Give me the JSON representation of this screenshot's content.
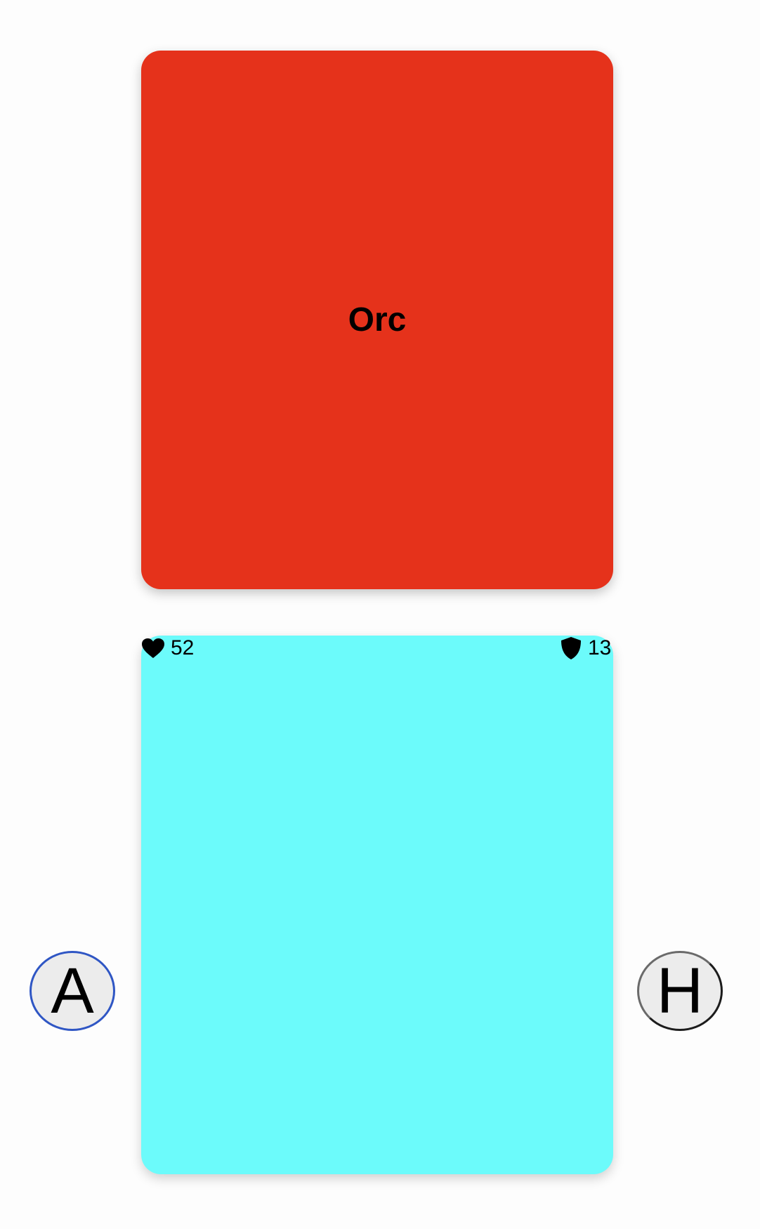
{
  "enemy": {
    "name": "Orc",
    "color": "#e5321b"
  },
  "player": {
    "color": "#6cfbfb",
    "health": "52",
    "defense": "13",
    "health_icon": "heart-icon",
    "defense_icon": "shield-icon"
  },
  "actions": {
    "attack_label": "A",
    "heal_label": "H"
  }
}
